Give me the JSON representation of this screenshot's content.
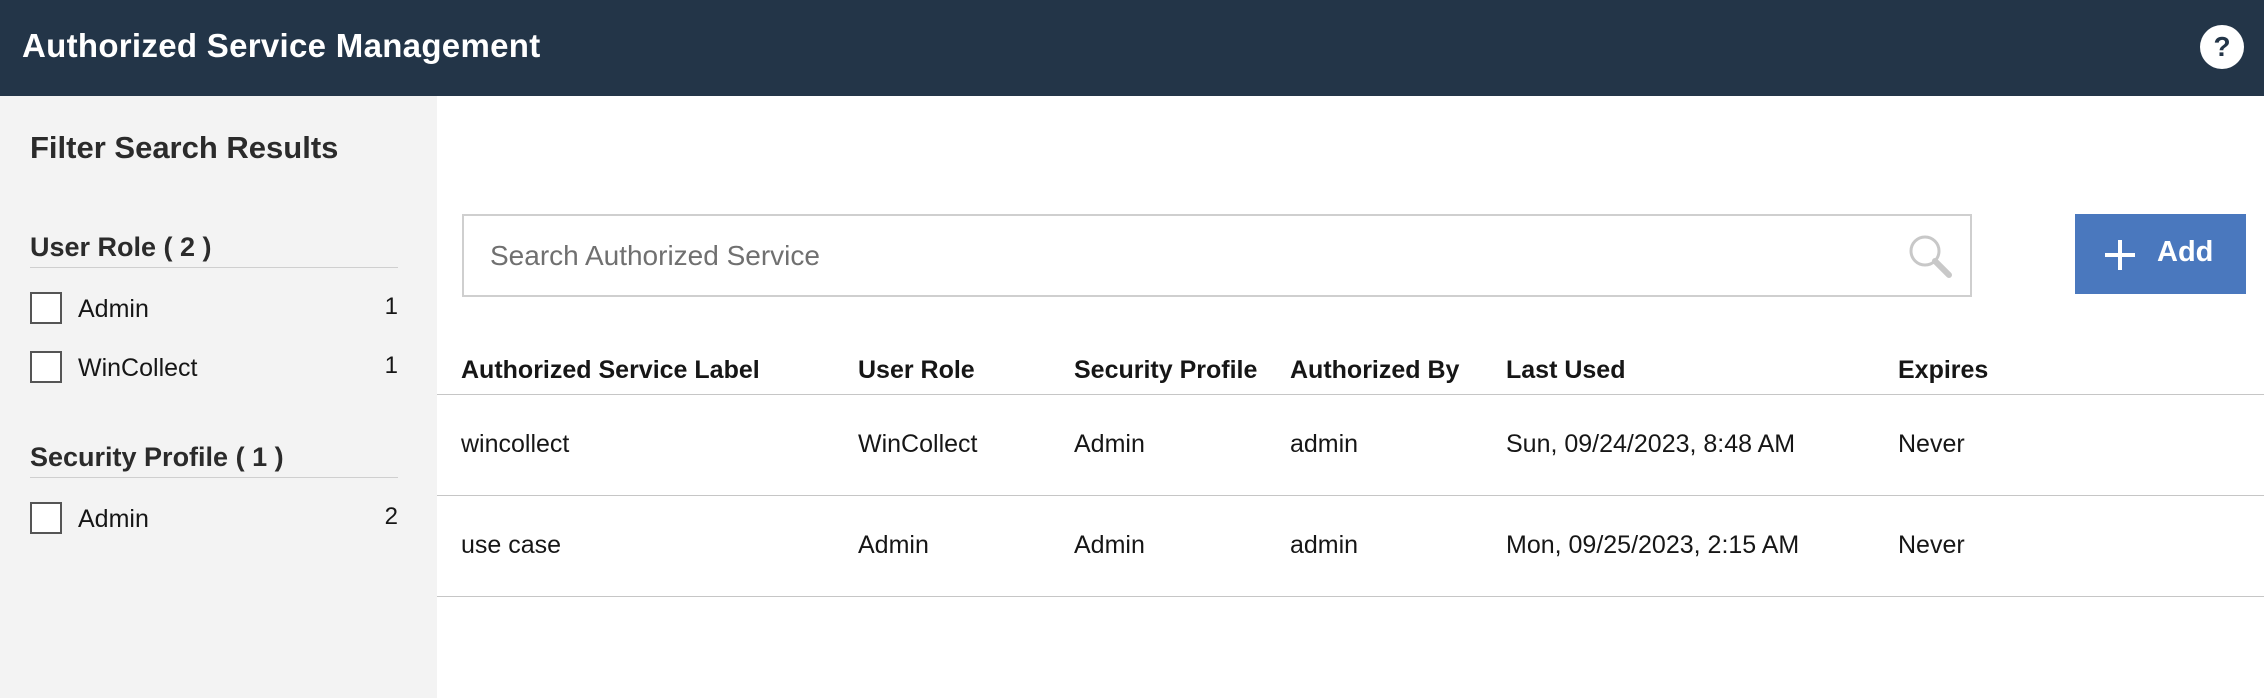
{
  "header": {
    "title": "Authorized Service Management",
    "help_label": "?"
  },
  "sidebar": {
    "title": "Filter Search Results",
    "groups": [
      {
        "heading": "User Role ( 2 )",
        "items": [
          {
            "label": "Admin",
            "count": "1"
          },
          {
            "label": "WinCollect",
            "count": "1"
          }
        ]
      },
      {
        "heading": "Security Profile ( 1 )",
        "items": [
          {
            "label": "Admin",
            "count": "2"
          }
        ]
      }
    ]
  },
  "search": {
    "placeholder": "Search Authorized Service",
    "value": ""
  },
  "toolbar": {
    "add_label": "Add"
  },
  "table": {
    "columns": [
      "Authorized Service Label",
      "User Role",
      "Security Profile",
      "Authorized By",
      "Last Used",
      "Expires"
    ],
    "rows": [
      [
        "wincollect",
        "WinCollect",
        "Admin",
        "admin",
        "Sun, 09/24/2023, 8:48 AM",
        "Never"
      ],
      [
        "use case",
        "Admin",
        "Admin",
        "admin",
        "Mon, 09/25/2023, 2:15 AM",
        "Never"
      ]
    ]
  },
  "icons": {
    "help": "help-icon",
    "search": "search-icon",
    "add": "plus-icon"
  },
  "colors": {
    "header_bg": "#233548",
    "accent": "#4a78be",
    "sidebar_bg": "#f3f3f3"
  }
}
